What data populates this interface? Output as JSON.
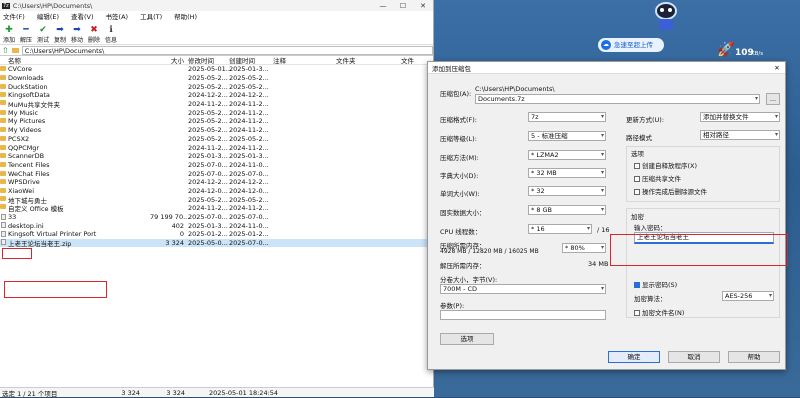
{
  "window": {
    "title": "C:\\Users\\HP\\Documents\\",
    "app_icon": "7z"
  },
  "menu": [
    "文件(F)",
    "编辑(E)",
    "查看(V)",
    "书签(A)",
    "工具(T)",
    "帮助(H)"
  ],
  "toolbar": [
    {
      "label": "添加",
      "icon": "plus-icon",
      "color": "#1e9b2e",
      "glyph": "✚"
    },
    {
      "label": "解压",
      "icon": "minus-icon",
      "color": "#1a4fb5",
      "glyph": "━"
    },
    {
      "label": "测试",
      "icon": "check-icon",
      "color": "#2a8d2a",
      "glyph": "✔"
    },
    {
      "label": "复制",
      "icon": "copy-arrow-icon",
      "color": "#1d46a8",
      "glyph": "➡"
    },
    {
      "label": "移动",
      "icon": "move-arrow-icon",
      "color": "#1d46a8",
      "glyph": "➡"
    },
    {
      "label": "删除",
      "icon": "delete-icon",
      "color": "#c81c1c",
      "glyph": "✖"
    },
    {
      "label": "信息",
      "icon": "info-icon",
      "color": "#333333",
      "glyph": "ℹ"
    }
  ],
  "address": "C:\\Users\\HP\\Documents\\",
  "columns": [
    "名称",
    "大小",
    "修改时间",
    "创建时间",
    "注释",
    "文件夹",
    "文件"
  ],
  "files": [
    {
      "name": "CVCore",
      "size": "",
      "mod": "2025-05-01...",
      "created": "2025-01-3...",
      "type": "folder"
    },
    {
      "name": "Downloads",
      "size": "",
      "mod": "2025-05-2...",
      "created": "2025-05-2...",
      "type": "folder"
    },
    {
      "name": "DuckStation",
      "size": "",
      "mod": "2025-05-2...",
      "created": "2025-05-2...",
      "type": "folder"
    },
    {
      "name": "KingsoftData",
      "size": "",
      "mod": "2024-12-2...",
      "created": "2024-12-2...",
      "type": "folder"
    },
    {
      "name": "MuMu共享文件夹",
      "size": "",
      "mod": "2024-11-2...",
      "created": "2024-11-2...",
      "type": "folder"
    },
    {
      "name": "My Music",
      "size": "",
      "mod": "2025-05-2...",
      "created": "2024-11-2...",
      "type": "folder"
    },
    {
      "name": "My Pictures",
      "size": "",
      "mod": "2025-05-2...",
      "created": "2024-11-2...",
      "type": "folder"
    },
    {
      "name": "My Videos",
      "size": "",
      "mod": "2025-05-2...",
      "created": "2024-11-2...",
      "type": "folder"
    },
    {
      "name": "PCSX2",
      "size": "",
      "mod": "2025-05-2...",
      "created": "2025-05-2...",
      "type": "folder"
    },
    {
      "name": "QQPCMgr",
      "size": "",
      "mod": "2024-11-2...",
      "created": "2024-11-2...",
      "type": "folder"
    },
    {
      "name": "ScannerDB",
      "size": "",
      "mod": "2025-01-3...",
      "created": "2025-01-3...",
      "type": "folder"
    },
    {
      "name": "Tencent Files",
      "size": "",
      "mod": "2025-07-0...",
      "created": "2024-11-0...",
      "type": "folder"
    },
    {
      "name": "WeChat Files",
      "size": "",
      "mod": "2025-07-0...",
      "created": "2025-07-0...",
      "type": "folder"
    },
    {
      "name": "WPSDrive",
      "size": "",
      "mod": "2024-12-2...",
      "created": "2024-12-2...",
      "type": "folder"
    },
    {
      "name": "XiaoWei",
      "size": "",
      "mod": "2024-12-0...",
      "created": "2024-12-0...",
      "type": "folder"
    },
    {
      "name": "地下城与勇士",
      "size": "",
      "mod": "2025-05-2...",
      "created": "2025-05-2...",
      "type": "folder"
    },
    {
      "name": "自定义 Office 模板",
      "size": "",
      "mod": "2024-11-2...",
      "created": "2024-11-2...",
      "type": "folder"
    },
    {
      "name": "33",
      "size": "79 199 70...",
      "mod": "2025-07-0...",
      "created": "2025-07-0...",
      "type": "file"
    },
    {
      "name": "desktop.ini",
      "size": "402",
      "mod": "2025-01-3...",
      "created": "2024-11-0...",
      "type": "file"
    },
    {
      "name": "Kingsoft Virtual Printer Port",
      "size": "0",
      "mod": "2025-01-2...",
      "created": "2025-01-2...",
      "type": "file"
    },
    {
      "name": "上老王论坛当老王.zip",
      "size": "3 324",
      "mod": "2025-05-0...",
      "created": "2025-07-0...",
      "type": "file"
    }
  ],
  "status": {
    "selection": "选定 1 / 21 个项目",
    "size1": "3 324",
    "size2": "3 324",
    "time": "2025-05-01 18:24:54"
  },
  "dialog": {
    "title": "添加到压缩包",
    "archive_label": "压缩包(A):",
    "archive_path": "C:\\Users\\HP\\Documents\\",
    "archive_name": "Documents.7z",
    "browse": "...",
    "format_label": "压缩格式(F):",
    "format": "7z",
    "level_label": "压缩等级(L):",
    "level": "5 - 标准压缩",
    "method_label": "压缩方法(M):",
    "method": "* LZMA2",
    "dict_label": "字典大小(D):",
    "dict": "* 32 MB",
    "word_label": "单词大小(W):",
    "word": "* 32",
    "solid_label": "固实数据大小：",
    "solid": "* 8 GB",
    "cpu_label": "CPU 线程数：",
    "cpu": "* 16",
    "cpu_max": "/ 16",
    "mem_label": "压缩所需内存：",
    "mem_detail": "4928 MB / 12820 MB / 16025 MB",
    "mem_pct": "* 80%",
    "dmem_label": "解压所需内存：",
    "dmem": "34 MB",
    "split_label": "分卷大小，字节(V):",
    "split": "700M - CD",
    "params_label": "参数(P):",
    "options_btn": "选项",
    "update_label": "更新方式(U):",
    "update": "添加并替换文件",
    "path_label": "路径模式",
    "path": "相对路径",
    "options_title": "选项",
    "opt_sfx": "创建自释放程序(X)",
    "opt_shared": "压缩共享文件",
    "opt_delete": "操作完成后删除源文件",
    "enc_title": "加密",
    "pwd_label": "输入密码：",
    "pwd_value": "上老王论坛当老王",
    "show_pwd": "显示密码(S)",
    "enc_method_label": "加密算法：",
    "enc_method": "AES-256",
    "enc_names": "加密文件名(N)",
    "ok": "确定",
    "cancel": "取消",
    "help": "帮助"
  },
  "desktop": {
    "boost": "急速至超上传",
    "speed": "109",
    "speed_unit": "KB/s"
  }
}
